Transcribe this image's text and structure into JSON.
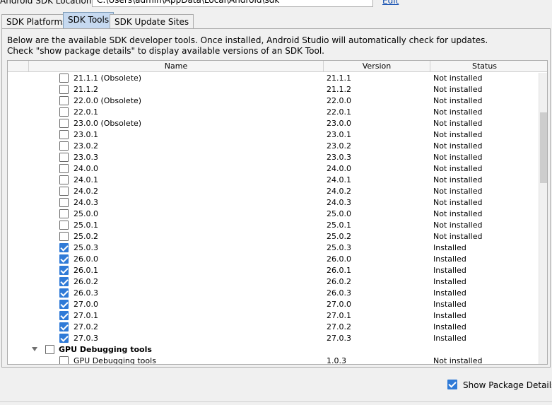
{
  "location": {
    "label": "Android SDK Location:",
    "path": "C:\\Users\\admin\\AppData\\Local\\Android\\sdk",
    "edit_label": "Edit"
  },
  "tabs": [
    {
      "label": "SDK Platforms",
      "active": false
    },
    {
      "label": "SDK Tools",
      "active": true
    },
    {
      "label": "SDK Update Sites",
      "active": false
    }
  ],
  "description": {
    "line1": "Below are the available SDK developer tools. Once installed, Android Studio will automatically check for updates.",
    "line2": "Check \"show package details\" to display available versions of an SDK Tool."
  },
  "table": {
    "columns": [
      "Name",
      "Version",
      "Status"
    ],
    "rows": [
      {
        "name": "21.1.1 (Obsolete)",
        "version": "21.1.1",
        "status": "Not installed",
        "checked": false
      },
      {
        "name": "21.1.2",
        "version": "21.1.2",
        "status": "Not installed",
        "checked": false
      },
      {
        "name": "22.0.0 (Obsolete)",
        "version": "22.0.0",
        "status": "Not installed",
        "checked": false
      },
      {
        "name": "22.0.1",
        "version": "22.0.1",
        "status": "Not installed",
        "checked": false
      },
      {
        "name": "23.0.0 (Obsolete)",
        "version": "23.0.0",
        "status": "Not installed",
        "checked": false
      },
      {
        "name": "23.0.1",
        "version": "23.0.1",
        "status": "Not installed",
        "checked": false
      },
      {
        "name": "23.0.2",
        "version": "23.0.2",
        "status": "Not installed",
        "checked": false
      },
      {
        "name": "23.0.3",
        "version": "23.0.3",
        "status": "Not installed",
        "checked": false
      },
      {
        "name": "24.0.0",
        "version": "24.0.0",
        "status": "Not installed",
        "checked": false
      },
      {
        "name": "24.0.1",
        "version": "24.0.1",
        "status": "Not installed",
        "checked": false
      },
      {
        "name": "24.0.2",
        "version": "24.0.2",
        "status": "Not installed",
        "checked": false
      },
      {
        "name": "24.0.3",
        "version": "24.0.3",
        "status": "Not installed",
        "checked": false
      },
      {
        "name": "25.0.0",
        "version": "25.0.0",
        "status": "Not installed",
        "checked": false
      },
      {
        "name": "25.0.1",
        "version": "25.0.1",
        "status": "Not installed",
        "checked": false
      },
      {
        "name": "25.0.2",
        "version": "25.0.2",
        "status": "Not installed",
        "checked": false
      },
      {
        "name": "25.0.3",
        "version": "25.0.3",
        "status": "Installed",
        "checked": true
      },
      {
        "name": "26.0.0",
        "version": "26.0.0",
        "status": "Installed",
        "checked": true
      },
      {
        "name": "26.0.1",
        "version": "26.0.1",
        "status": "Installed",
        "checked": true
      },
      {
        "name": "26.0.2",
        "version": "26.0.2",
        "status": "Installed",
        "checked": true
      },
      {
        "name": "26.0.3",
        "version": "26.0.3",
        "status": "Installed",
        "checked": true
      },
      {
        "name": "27.0.0",
        "version": "27.0.0",
        "status": "Installed",
        "checked": true
      },
      {
        "name": "27.0.1",
        "version": "27.0.1",
        "status": "Installed",
        "checked": true
      },
      {
        "name": "27.0.2",
        "version": "27.0.2",
        "status": "Installed",
        "checked": true
      },
      {
        "name": "27.0.3",
        "version": "27.0.3",
        "status": "Installed",
        "checked": true
      },
      {
        "name": "GPU Debugging tools",
        "version": "",
        "status": "",
        "checked": false,
        "group": true
      },
      {
        "name": "GPU Debugging tools",
        "version": "1.0.3",
        "status": "Not installed",
        "checked": false
      }
    ]
  },
  "show_package_details": {
    "label": "Show Package Details",
    "checked": true
  },
  "colors": {
    "accent": "#2f7ad7",
    "active_tab": "#c6d9f0"
  }
}
